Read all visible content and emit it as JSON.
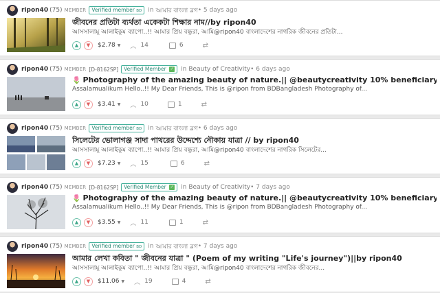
{
  "posts": [
    {
      "author": "ripon40",
      "reputation": "(75)",
      "member_label": "MEMBER",
      "id_badge": "",
      "verified_label": "Verified member",
      "verified_suffix": "BD",
      "in_word": "in",
      "community": "আমার বাংলা ব্লগ",
      "age": "• 5 days ago",
      "title_flower": "",
      "title": "জীবনের প্রতিটা ব্যর্থতা একেকটা শিক্ষার নাম//by ripon40",
      "summary": "আসসালামু আলাইকুম ব্যাপো..!! আমার প্রিয় বন্ধুরা, আমি@ripon40 বাংলাদেশের নাগরিক জীবনের প্রতিটা...",
      "payout": "$2.78",
      "voters": "14",
      "comments": "6",
      "thumb": "forest"
    },
    {
      "author": "ripon40",
      "reputation": "(75)",
      "member_label": "MEMBER",
      "id_badge": "[D-8162SP]",
      "verified_label": "Verified Member",
      "verified_suffix": "",
      "in_word": "in",
      "community": "Beauty of Creativity",
      "age": "• 6 days ago",
      "title_flower": "🌷",
      "title": "Photography of the amazing beauty of nature.|| @beautycreativity 10% beneficiary by ripon40",
      "summary": "Assalamualikum Hello..!! My Dear Friends, This is @ripon from BDBangladesh Photography of...",
      "payout": "$3.41",
      "voters": "10",
      "comments": "1",
      "thumb": "silhouette"
    },
    {
      "author": "ripon40",
      "reputation": "(75)",
      "member_label": "MEMBER",
      "id_badge": "",
      "verified_label": "Verified member",
      "verified_suffix": "BD",
      "in_word": "in",
      "community": "আমার বাংলা ব্লগ",
      "age": "• 6 days ago",
      "title_flower": "",
      "title": "সিলেটের ভোলাগঞ্জ সাদা পাথরের উদ্দেশ্যে নৌকায় যাত্রা // by ripon40",
      "summary": "আসসালামু আলাইকুম ব্যাপো..!! আমার প্রিয় বন্ধুরা, আমি@ripon40 বাংলাদেশের নাগরিক সিলেটের...",
      "payout": "$7.23",
      "voters": "15",
      "comments": "6",
      "thumb": "collage"
    },
    {
      "author": "ripon40",
      "reputation": "(75)",
      "member_label": "MEMBER",
      "id_badge": "[D-8162SP]",
      "verified_label": "Verified Member",
      "verified_suffix": "",
      "in_word": "in",
      "community": "Beauty of Creativity",
      "age": "• 7 days ago",
      "title_flower": "🌷",
      "title": "Photography of the amazing beauty of nature.|| @beautycreativity 10% beneficiary by ripon40",
      "summary": "Assalamualikum Hello..!! My Dear Friends, This is @ripon from BDBangladesh Photography of...",
      "payout": "$3.55",
      "voters": "11",
      "comments": "1",
      "thumb": "tree"
    },
    {
      "author": "ripon40",
      "reputation": "(75)",
      "member_label": "MEMBER",
      "id_badge": "",
      "verified_label": "Verified member",
      "verified_suffix": "BD",
      "in_word": "in",
      "community": "আমার বাংলা ব্লগ",
      "age": "• 7 days ago",
      "title_flower": "",
      "title": "আমার লেখা কবিতা \" জীবনের যাত্রা \" (Poem of my writing \"Life's journey\")||by ripon40",
      "summary": "আসসালামু আলাইকুম ব্যাপো..!! আমার প্রিয় বন্ধুরা, আমি@ripon40 বাংলাদেশের নাগরিক জীবনের...",
      "payout": "$11.06",
      "voters": "19",
      "comments": "4",
      "thumb": "sunset"
    }
  ],
  "icons": {
    "upvote": "chevron-up-icon",
    "downvote": "chevron-down-icon",
    "voters": "voters-icon",
    "comments": "comment-icon",
    "reblog": "reblog-icon"
  },
  "colors": {
    "verified_border": "#46b29c",
    "upvote": "#3fa88a",
    "downvote": "#e06060"
  }
}
